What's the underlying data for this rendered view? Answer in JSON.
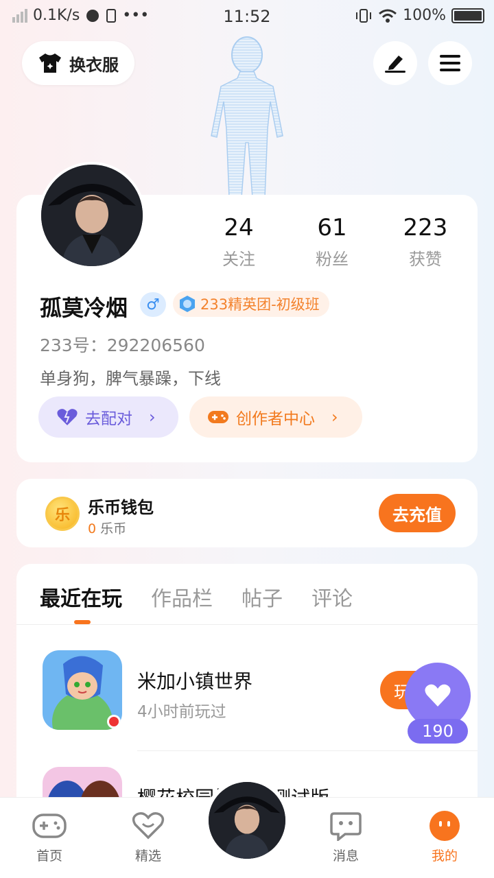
{
  "status_bar": {
    "net_speed": "0.1K/s",
    "time": "11:52",
    "battery": "100%"
  },
  "header": {
    "outfit_label": "换衣服"
  },
  "profile": {
    "stats": [
      {
        "value": "24",
        "label": "关注"
      },
      {
        "value": "61",
        "label": "粉丝"
      },
      {
        "value": "223",
        "label": "获赞"
      }
    ],
    "nickname": "孤莫冷烟",
    "gender_symbol": "♂",
    "badge": "233精英团-初级班",
    "uid": "233号：292206560",
    "bio": "单身狗，脾气暴躁，下线",
    "match_label": "去配对",
    "creator_label": "创作者中心"
  },
  "wallet": {
    "coin_glyph": "乐",
    "title": "乐币钱包",
    "amount": "0",
    "unit": "乐币",
    "recharge_label": "去充值"
  },
  "tabs": [
    "最近在玩",
    "作品栏",
    "帖子",
    "评论"
  ],
  "games": [
    {
      "name": "米加小镇世界",
      "sub": "4小时前玩过",
      "button": "玩"
    },
    {
      "name": "樱花校园模拟器测试版",
      "sub": "",
      "button": ""
    }
  ],
  "like": {
    "count": "190"
  },
  "bottom_nav": [
    {
      "label": "首页"
    },
    {
      "label": "精选"
    },
    {
      "label": "消息"
    },
    {
      "label": "我的"
    }
  ],
  "colors": {
    "accent": "#f8741e",
    "purple": "#8a79f4"
  }
}
